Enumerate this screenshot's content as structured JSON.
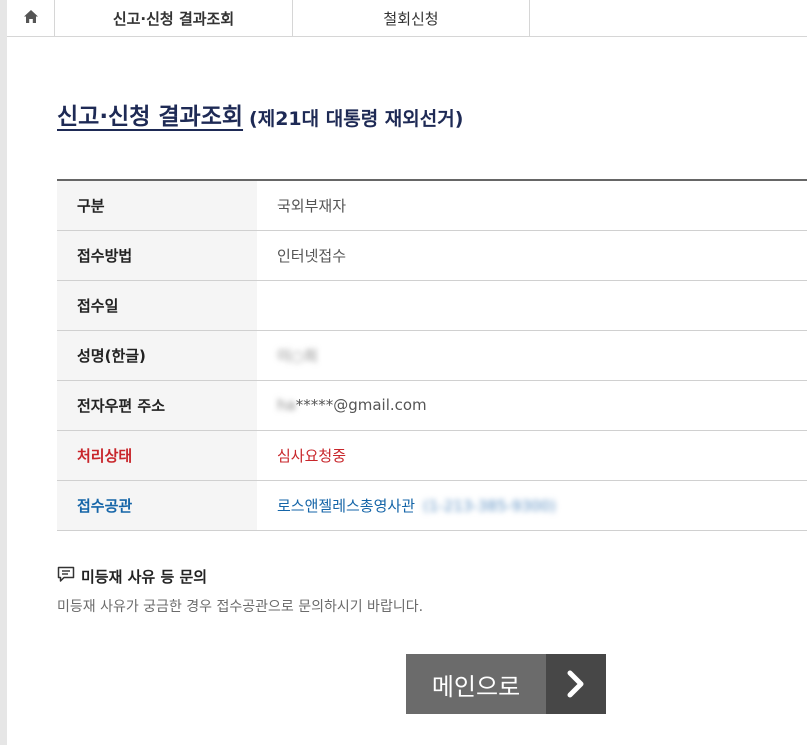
{
  "tabs": {
    "home_icon": "home-icon",
    "items": [
      {
        "label": "신고·신청 결과조회"
      },
      {
        "label": "철회신청"
      }
    ]
  },
  "heading": {
    "title": "신고·신청 결과조회",
    "subtitle": "(제21대 대통령 재외선거)"
  },
  "info_rows": [
    {
      "label": "구분",
      "value": "국외부재자"
    },
    {
      "label": "접수방법",
      "value": "인터넷접수"
    },
    {
      "label": "접수일",
      "value": ""
    },
    {
      "label": "성명(한글)",
      "value": "이○희"
    },
    {
      "label": "전자우편 주소",
      "value_masked_prefix": "ha",
      "value": "*****@gmail.com"
    },
    {
      "label": "처리상태",
      "value": "심사요청중"
    },
    {
      "label": "접수공관",
      "value": "로스앤젤레스총영사관",
      "phone": "(1-213-385-9300)"
    }
  ],
  "colors": {
    "status": "#c8262b",
    "office": "#1565a8",
    "heading": "#1e2a55"
  },
  "inquiry": {
    "icon": "chat-icon",
    "title": "미등재 사유 등 문의",
    "description": "미등재 사유가 궁금한 경우 접수공관으로 문의하시기 바랍니다."
  },
  "main_button": {
    "label": "메인으로",
    "icon": "chevron-right-icon"
  }
}
